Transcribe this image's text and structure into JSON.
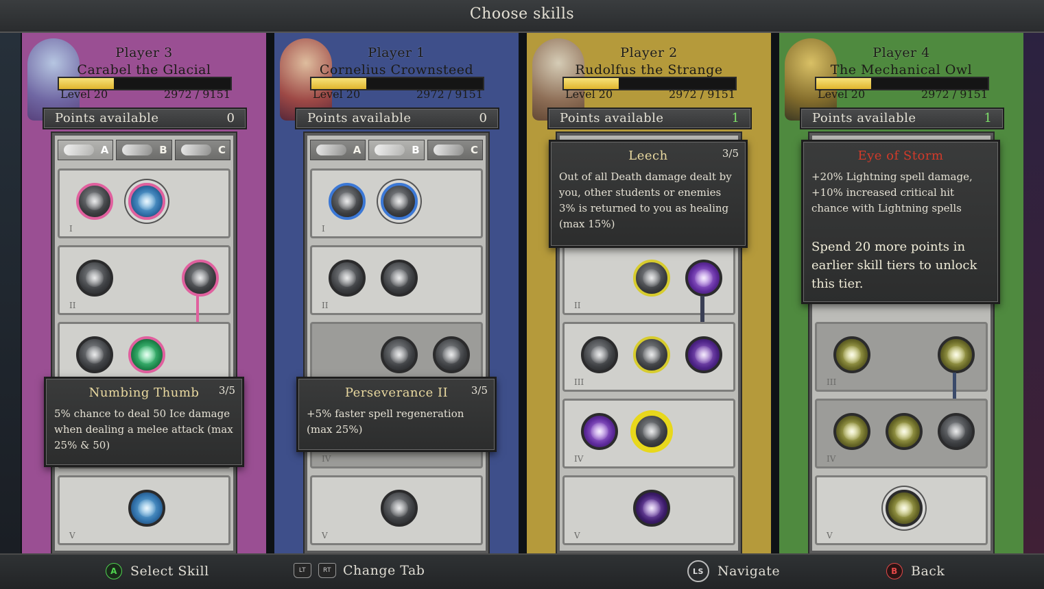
{
  "screen_title": "Choose skills",
  "columns": [
    {
      "player": "Player 3",
      "character": "Carabel the Glacial",
      "level": "Level 20",
      "xp": "2972 / 9151",
      "xp_fraction": 0.32,
      "points_label": "Points available",
      "points_value": "0",
      "bg": "#9a4f93",
      "accent": "#e0609e",
      "active_tab": 0,
      "tabs": [
        "A",
        "B",
        "C"
      ],
      "tooltip": {
        "title": "Numbing Thumb",
        "rank": "3/5",
        "desc": "5% chance to deal 50 Ice damage when dealing a melee attack (max 25% & 50)"
      }
    },
    {
      "player": "Player 1",
      "character": "Cornelius Crownsteed",
      "level": "Level 20",
      "xp": "2972 / 9151",
      "xp_fraction": 0.32,
      "points_label": "Points available",
      "points_value": "0",
      "bg": "#3e4f8a",
      "accent": "#3b78d6",
      "active_tab": 1,
      "tabs": [
        "A",
        "B",
        "C"
      ],
      "tooltip": {
        "title": "Perseverance II",
        "rank": "3/5",
        "desc": "+5% faster spell regeneration (max 25%)"
      }
    },
    {
      "player": "Player 2",
      "character": "Rudolfus the Strange",
      "level": "Level 20",
      "xp": "2972 / 9151",
      "xp_fraction": 0.32,
      "points_label": "Points available",
      "points_value": "1",
      "bg": "#b59a3b",
      "accent": "#d7cc2e",
      "tooltip": {
        "title": "Leech",
        "rank": "3/5",
        "desc": "Out of all Death damage dealt by you, other students or enemies 3% is returned to you as healing (max 15%)"
      }
    },
    {
      "player": "Player 4",
      "character": "The Mechanical Owl",
      "level": "Level 20",
      "xp": "2972 / 9151",
      "xp_fraction": 0.32,
      "points_label": "Points available",
      "points_value": "1",
      "bg": "#4f8a3f",
      "accent": "#c9c43a",
      "tooltip": {
        "title": "Eye of Storm",
        "rank": "",
        "desc": "+20% Lightning spell damage, +10% increased critical hit chance with Lightning spells",
        "warning": "Spend 20 more points in earlier skill tiers to unlock this tier."
      }
    }
  ],
  "tier_numerals": [
    "I",
    "II",
    "III",
    "IV",
    "V"
  ],
  "footer": {
    "select": {
      "glyph": "A",
      "label": "Select Skill"
    },
    "change_tab": {
      "lt": "LT",
      "rt": "RT",
      "label": "Change Tab"
    },
    "navigate": {
      "glyph": "LS",
      "label": "Navigate"
    },
    "back": {
      "glyph": "B",
      "label": "Back"
    }
  },
  "colors": {
    "points_zero": "#e8e4d8",
    "points_positive": "#7fe06a",
    "tooltip_title_normal": "#e9d9a0",
    "tooltip_title_locked": "#d23a2a"
  }
}
